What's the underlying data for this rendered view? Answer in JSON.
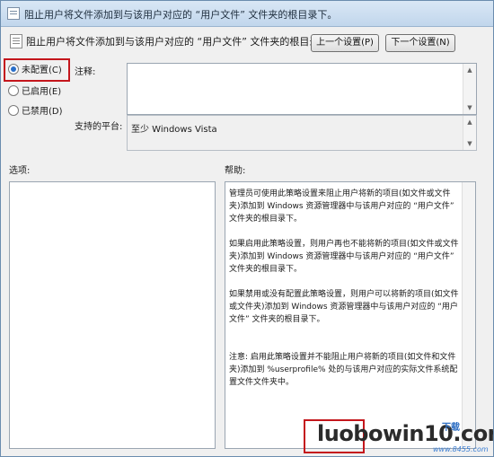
{
  "window": {
    "title": "阻止用户将文件添加到与该用户对应的 “用户文件” 文件夹的根目录下。"
  },
  "header": {
    "policy_name": "阻止用户将文件添加到与该用户对应的 “用户文件” 文件夹的根目录下。",
    "prev_button": "上一个设置(P)",
    "next_button": "下一个设置(N)"
  },
  "state": {
    "options": [
      {
        "label": "未配置(C)",
        "checked": true
      },
      {
        "label": "已启用(E)",
        "checked": false
      },
      {
        "label": "已禁用(D)",
        "checked": false
      }
    ]
  },
  "comment": {
    "label": "注释:",
    "value": ""
  },
  "platform": {
    "label": "支持的平台:",
    "value": "至少 Windows Vista"
  },
  "sections": {
    "options_label": "选项:",
    "help_label": "帮助:"
  },
  "help": {
    "p1": "管理员可使用此策略设置来阻止用户将新的项目(如文件或文件夹)添加到 Windows 资源管理器中与该用户对应的 “用户文件” 文件夹的根目录下。",
    "p2": "如果启用此策略设置，则用户再也不能将新的项目(如文件或文件夹)添加到 Windows 资源管理器中与该用户对应的 “用户文件” 文件夹的根目录下。",
    "p3": "如果禁用或没有配置此策略设置，则用户可以将新的项目(如文件或文件夹)添加到 Windows 资源管理器中与该用户对应的 “用户文件” 文件夹的根目录下。",
    "p4": "注意: 启用此策略设置并不能阻止用户将新的项目(如文件和文件夹)添加到 %userprofile% 处的与该用户对应的实际文件系统配置文件文件夹中。"
  },
  "watermark": {
    "text": "luobowin10.com",
    "badge": "下载",
    "small": "www.8455.com"
  },
  "colors": {
    "highlight": "#c4161c",
    "radio_selected": "#2a6fc9"
  }
}
